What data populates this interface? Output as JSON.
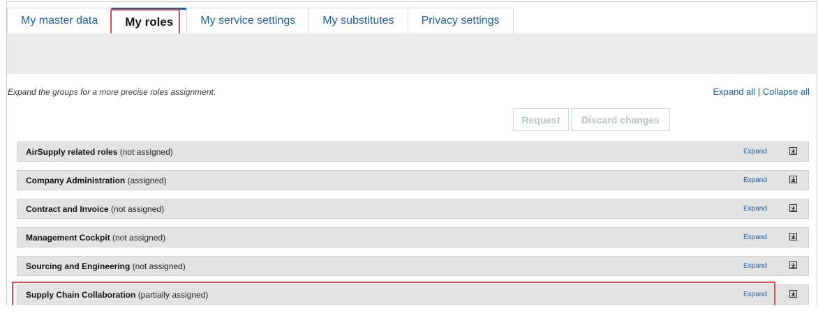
{
  "tabs": [
    {
      "label": "My master data",
      "active": false
    },
    {
      "label": "My roles",
      "active": true
    },
    {
      "label": "My service settings",
      "active": false
    },
    {
      "label": "My substitutes",
      "active": false
    },
    {
      "label": "Privacy settings",
      "active": false
    }
  ],
  "hint": "Expand the groups for a more precise roles assignment.",
  "expand_all": "Expand all",
  "separator": "|",
  "collapse_all": "Collapse all",
  "buttons": {
    "request": "Request",
    "discard": "Discard changes"
  },
  "groups": [
    {
      "name": "AirSupply related roles",
      "status": "(not assigned)",
      "expand": "Expand"
    },
    {
      "name": "Company Administration",
      "status": "(assigned)",
      "expand": "Expand"
    },
    {
      "name": "Contract and Invoice",
      "status": "(not assigned)",
      "expand": "Expand"
    },
    {
      "name": "Management Cockpit",
      "status": "(not assigned)",
      "expand": "Expand"
    },
    {
      "name": "Sourcing and Engineering",
      "status": "(not assigned)",
      "expand": "Expand"
    },
    {
      "name": "Supply Chain Collaboration",
      "status": "(partially assigned)",
      "expand": "Expand"
    }
  ],
  "colors": {
    "link": "#1a5fa6",
    "highlight": "#e0474c",
    "group_bg": "#e3e3e3"
  }
}
